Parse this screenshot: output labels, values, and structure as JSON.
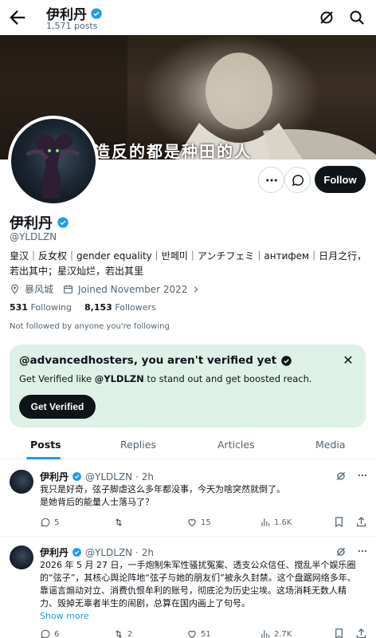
{
  "header": {
    "title": "伊利丹",
    "posts_count": "1,571 posts"
  },
  "banner": {
    "subtitle": "来造反的都是种田的人"
  },
  "profile": {
    "name": "伊利丹",
    "handle": "@YLDLZN",
    "bio": "皇汉｜反女权｜gender equality｜반페미｜アンチフェミ｜антифем｜日月之行，若出其中；星汉灿烂，若出其里",
    "location": "暴风城",
    "joined": "Joined November 2022",
    "following_count": "531",
    "following_label": "Following",
    "followers_count": "8,153",
    "followers_label": "Followers",
    "not_followed": "Not followed by anyone you're following",
    "follow_label": "Follow"
  },
  "verify_card": {
    "title": "@advancedhosters, you aren't verified yet",
    "text_prefix": "Get Verified like ",
    "text_handle": "@YLDLZN",
    "text_suffix": " to stand out and get boosted reach.",
    "button": "Get Verified",
    "close": "✕"
  },
  "tabs": [
    {
      "label": "Posts"
    },
    {
      "label": "Replies"
    },
    {
      "label": "Articles"
    },
    {
      "label": "Media"
    }
  ],
  "tweets": [
    {
      "name": "伊利丹",
      "handle": "@YLDLZN",
      "time": "· 2h",
      "body": "我只是好奇，弦子脚虐这么多年都没事，今天为啥突然就倒了。\n是她背后的能量人士落马了？",
      "replies": "5",
      "reposts": "",
      "likes": "15",
      "views": "1.6K"
    },
    {
      "name": "伊利丹",
      "handle": "@YLDLZN",
      "time": "· 2h",
      "body": "2026 年 5 月 27 日，一手炮制朱军性骚扰冤案、透支公众信任、搅乱半个娱乐圈的“弦子”，其核心舆论阵地“弦子与她的朋友们”被永久封禁。这个盘踞网络多年、靠谣言煽动对立、消费仇恨牟利的账号，彻底沦为历史尘埃。这场消耗无数人精力、毁掉无辜者半生的闹剧，总算在国内画上了句号。",
      "show_more": "Show more",
      "replies": "6",
      "reposts": "2",
      "likes": "51",
      "views": "2.7K"
    }
  ],
  "colors": {
    "accent": "#1d9bf0",
    "verified": "#1d9bf0",
    "text": "#0f1419",
    "muted": "#536471",
    "card_bg": "#def1e7"
  }
}
